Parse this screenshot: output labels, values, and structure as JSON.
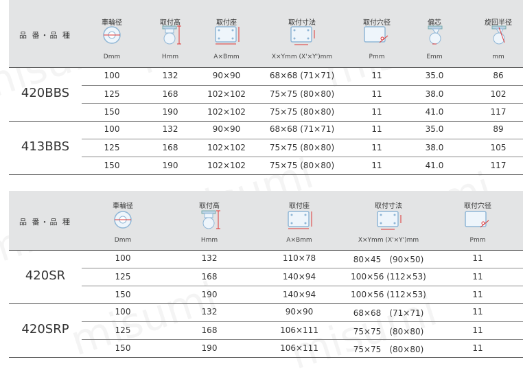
{
  "watermark": "misumi",
  "table1": {
    "product_label": "品 番・品 種",
    "headers": [
      {
        "title": "車輪径",
        "unit": "Dmm",
        "icon": "wheel-diameter-icon"
      },
      {
        "title": "取付高",
        "unit": "Hmm",
        "icon": "mount-height-icon"
      },
      {
        "title": "取付座",
        "unit": "A×Bmm",
        "icon": "mount-plate-icon"
      },
      {
        "title": "取付寸法",
        "unit": "X×Ymm (X'×Y')mm",
        "icon": "mount-dimension-icon"
      },
      {
        "title": "取付穴径",
        "unit": "Pmm",
        "icon": "hole-diameter-icon"
      },
      {
        "title": "偏芯",
        "unit": "Emm",
        "icon": "offset-icon"
      },
      {
        "title": "旋回半径",
        "unit": "mm",
        "icon": "swivel-radius-icon"
      }
    ],
    "groups": [
      {
        "name": "420BBS",
        "rows": [
          [
            "100",
            "132",
            "90×90",
            "68×68 (71×71)",
            "11",
            "35.0",
            "86"
          ],
          [
            "125",
            "168",
            "102×102",
            "75×75 (80×80)",
            "11",
            "38.0",
            "102"
          ],
          [
            "150",
            "190",
            "102×102",
            "75×75 (80×80)",
            "11",
            "41.0",
            "117"
          ]
        ]
      },
      {
        "name": "413BBS",
        "rows": [
          [
            "100",
            "132",
            "90×90",
            "68×68 (71×71)",
            "11",
            "35.0",
            "89"
          ],
          [
            "125",
            "168",
            "102×102",
            "75×75 (80×80)",
            "11",
            "38.0",
            "105"
          ],
          [
            "150",
            "190",
            "102×102",
            "75×75 (80×80)",
            "11",
            "41.0",
            "117"
          ]
        ]
      }
    ]
  },
  "table2": {
    "product_label": "品 番・品 種",
    "headers": [
      {
        "title": "車輪径",
        "unit": "Dmm",
        "icon": "wheel-diameter-icon"
      },
      {
        "title": "取付高",
        "unit": "Hmm",
        "icon": "mount-height-icon"
      },
      {
        "title": "取付座",
        "unit": "A×Bmm",
        "icon": "mount-plate-icon"
      },
      {
        "title": "取付寸法",
        "unit": "X×Ymm (X'×Y')mm",
        "icon": "mount-dimension-icon"
      },
      {
        "title": "取付穴径",
        "unit": "Pmm",
        "icon": "hole-diameter-icon"
      }
    ],
    "groups": [
      {
        "name": "420SR",
        "rows": [
          [
            "100",
            "132",
            "110×78",
            "80×45　(90×50)",
            "11"
          ],
          [
            "125",
            "168",
            "140×94",
            "100×56 (112×53)",
            "11"
          ],
          [
            "150",
            "190",
            "140×94",
            "100×56 (112×53)",
            "11"
          ]
        ]
      },
      {
        "name": "420SRP",
        "rows": [
          [
            "100",
            "132",
            "90×90",
            "68×68　(71×71)",
            "11"
          ],
          [
            "125",
            "168",
            "106×111",
            "75×75　(80×80)",
            "11"
          ],
          [
            "150",
            "190",
            "106×111",
            "75×75　(80×80)",
            "11"
          ]
        ]
      }
    ]
  }
}
